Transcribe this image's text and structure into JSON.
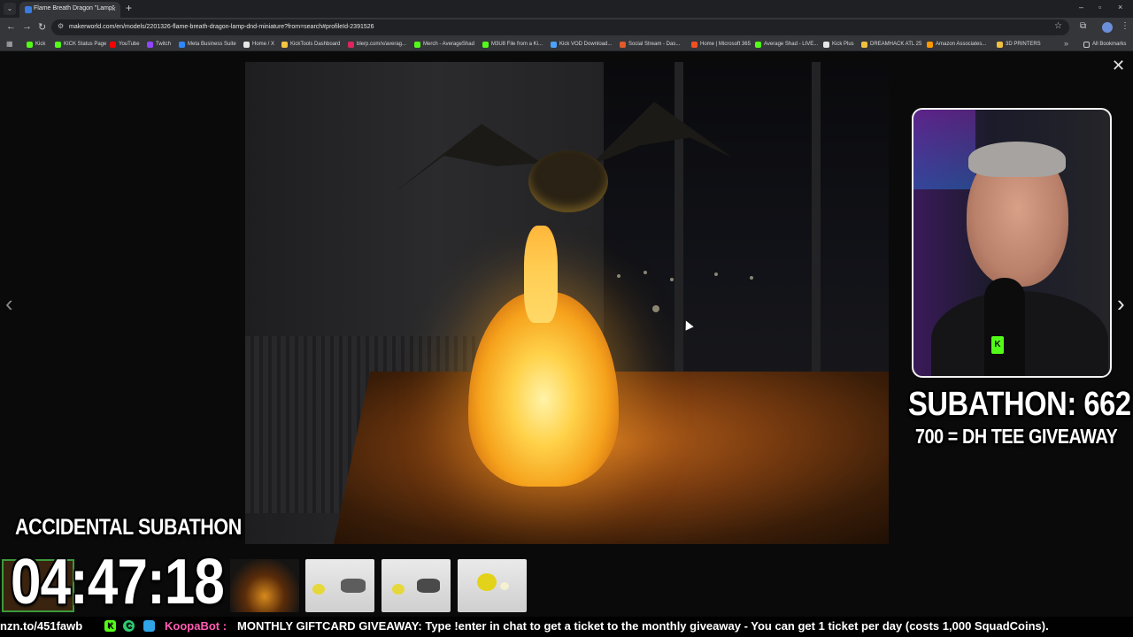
{
  "browser": {
    "tab": {
      "title": "Flame Breath Dragon \"Lamp\"",
      "close": "×"
    },
    "new_tab": "+",
    "window_controls": {
      "minimize": "–",
      "maximize": "▫",
      "close": "×"
    },
    "nav": {
      "back": "←",
      "forward": "→",
      "reload": "↻"
    },
    "url": "makerworld.com/en/models/2201326-flame-breath-dragon-lamp-dnd-miniature?from=search#profileId-2391526",
    "bookmarks": [
      {
        "label": "Kick",
        "color": "#53fc18"
      },
      {
        "label": "KICK Status Page",
        "color": "#53fc18"
      },
      {
        "label": "YouTube",
        "color": "#ff0000"
      },
      {
        "label": "Twitch",
        "color": "#9146ff"
      },
      {
        "label": "Meta Business Suite",
        "color": "#2d88ff"
      },
      {
        "label": "Home / X",
        "color": "#e7e7e7"
      },
      {
        "label": "KickTools Dashboard",
        "color": "#f5c542"
      },
      {
        "label": "blerp.com/x/averag...",
        "color": "#e0245e"
      },
      {
        "label": "Merch - AverageShad",
        "color": "#53fc18"
      },
      {
        "label": "M3U8 File from a Ki...",
        "color": "#53fc18"
      },
      {
        "label": "Kick VOD Download...",
        "color": "#4aa3ff"
      },
      {
        "label": "Social Stream - Das...",
        "color": "#e05a2a"
      },
      {
        "label": "Home | Microsoft 365",
        "color": "#f25022"
      },
      {
        "label": "Average Shad - LIVE...",
        "color": "#53fc18"
      },
      {
        "label": "Kick Plus",
        "color": "#e7e7e7"
      },
      {
        "label": "DREAMHACK ATL 25",
        "color": "#f0c040"
      },
      {
        "label": "Amazon Associates...",
        "color": "#ff9900"
      },
      {
        "label": "3D PRINTERS",
        "color": "#f0c040"
      }
    ],
    "all_bookmarks": "All Bookmarks"
  },
  "viewer": {
    "close": "✕",
    "prev": "‹",
    "next": "›"
  },
  "stream_overlay": {
    "subathon_count": "SUBATHON: 662",
    "subathon_goal": "700 = DH TEE GIVEAWAY",
    "accidental_title": "ACCIDENTAL SUBATHON",
    "timer": "04:47:18"
  },
  "ticker": {
    "link": "nzn.to/451fawb",
    "badge_kick": "K",
    "badge_c": "C",
    "badge_k2": "K",
    "user": "KoopaBot :",
    "message": "MONTHLY GIFTCARD GIVEAWAY: Type !enter in chat to get a ticket to the monthly giveaway - You can get 1 ticket per day (costs 1,000 SquadCoins)."
  },
  "colors": {
    "kick_green": "#53fc18",
    "koopabot_pink": "#ff5db1"
  }
}
